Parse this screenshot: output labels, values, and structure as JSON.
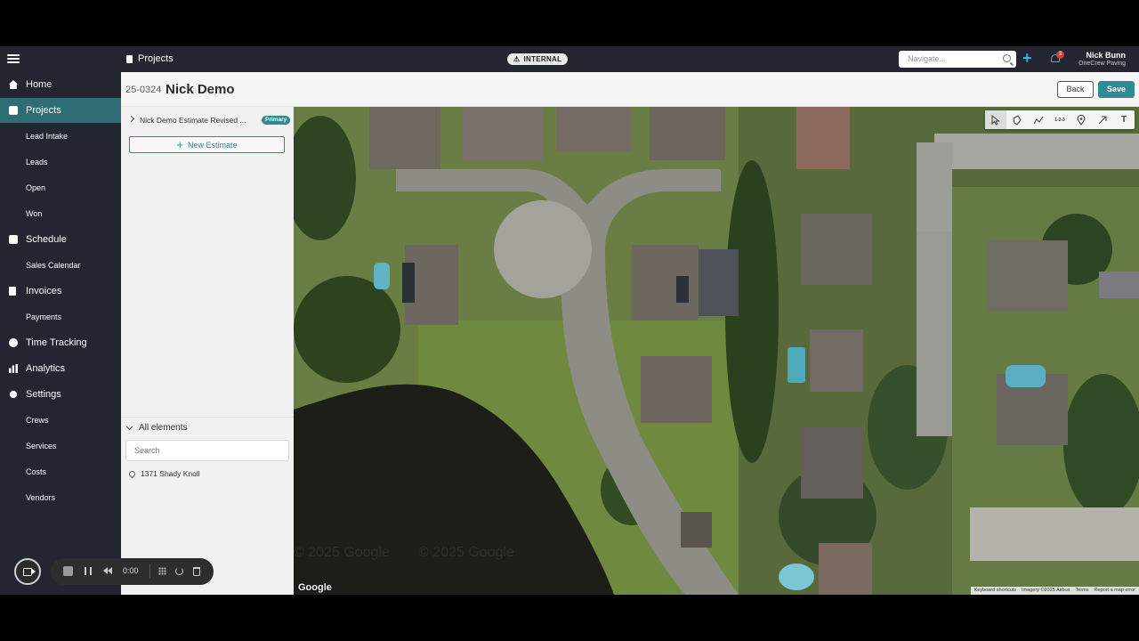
{
  "topbar": {
    "breadcrumb": "Projects",
    "environment_badge": "INTERNAL",
    "navigate_placeholder": "Navigate...",
    "notification_count": "3",
    "user_name": "Nick Bunn",
    "company": "OneCrew Paving"
  },
  "sidebar": {
    "items": [
      {
        "label": "Home",
        "icon": "home-icon"
      },
      {
        "label": "Projects",
        "icon": "folder-icon",
        "active": true
      },
      {
        "label": "Lead Intake"
      },
      {
        "label": "Leads"
      },
      {
        "label": "Open"
      },
      {
        "label": "Won"
      },
      {
        "label": "Schedule",
        "icon": "calendar-icon"
      },
      {
        "label": "Sales Calendar"
      },
      {
        "label": "Invoices",
        "icon": "invoice-icon"
      },
      {
        "label": "Payments"
      },
      {
        "label": "Time Tracking",
        "icon": "clock-icon"
      },
      {
        "label": "Analytics",
        "icon": "bar-chart-icon"
      },
      {
        "label": "Settings",
        "icon": "gear-icon"
      },
      {
        "label": "Crews"
      },
      {
        "label": "Services"
      },
      {
        "label": "Costs"
      },
      {
        "label": "Vendors"
      }
    ]
  },
  "recorder": {
    "time": "0:00"
  },
  "project": {
    "number": "25-0324",
    "name": "Nick Demo",
    "back_label": "Back",
    "save_label": "Save"
  },
  "estimates": {
    "items": [
      {
        "name": "Nick Demo Estimate Revised ...",
        "badge": "Primary"
      }
    ],
    "new_label": "New Estimate"
  },
  "elements": {
    "header": "All elements",
    "search_placeholder": "Search",
    "items": [
      {
        "label": "1371 Shady Knoll",
        "icon": "map-pin-icon"
      }
    ]
  },
  "map": {
    "provider": "Google",
    "watermark": "© 2025 Google",
    "attribution": [
      "Keyboard shortcuts",
      "Imagery ©2025 Airbus",
      "Terms",
      "Report a map error"
    ],
    "tools": [
      "pointer-icon",
      "polygon-icon",
      "polyline-icon",
      "measure-icon",
      "marker-icon",
      "arrow-icon",
      "text-icon"
    ],
    "tool_label_measure": "1-2-3",
    "tool_label_text": "T"
  }
}
